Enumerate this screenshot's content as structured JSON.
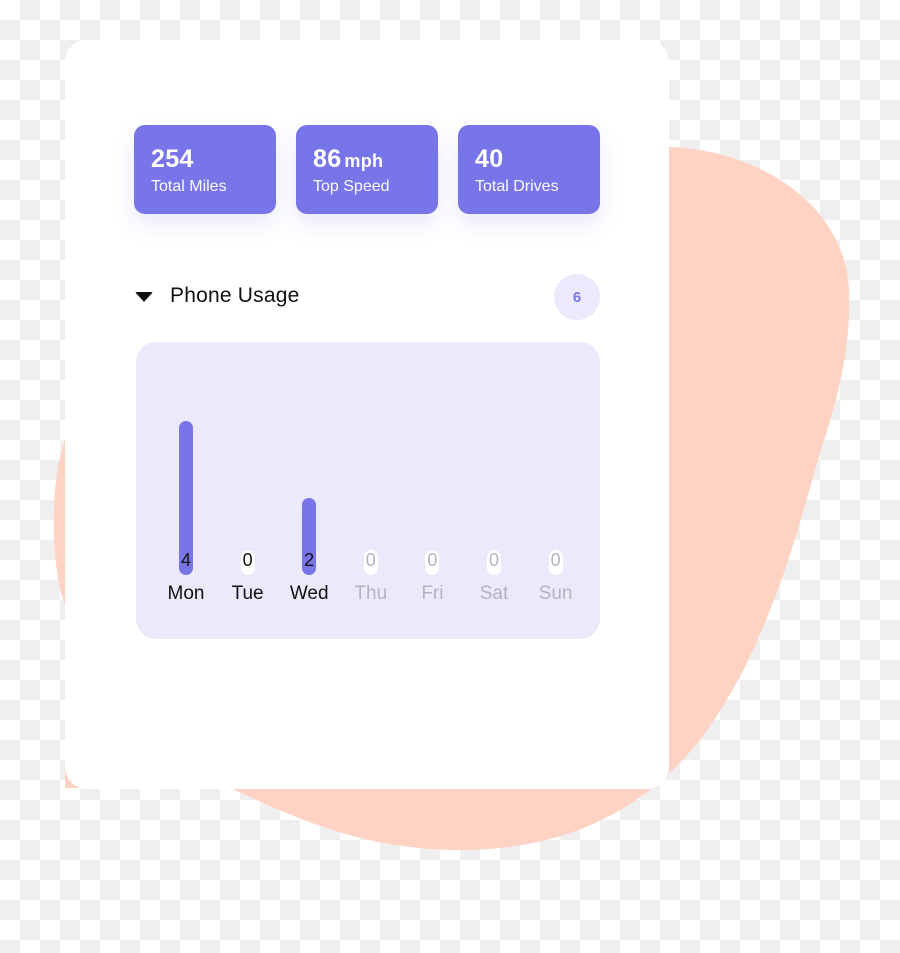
{
  "colors": {
    "accent": "#7775e8",
    "panel_bg": "#ebe9fa",
    "badge_bg": "#ebe9fb",
    "blob": "#fed3c3",
    "active_text": "#111111",
    "inactive_text": "#b4b3c2",
    "empty_bar": "#ffffff"
  },
  "stats": [
    {
      "value": "254",
      "unit": "",
      "label": "Total Miles"
    },
    {
      "value": "86",
      "unit": "mph",
      "label": "Top Speed"
    },
    {
      "value": "40",
      "unit": "",
      "label": "Total Drives"
    }
  ],
  "section": {
    "title": "Phone Usage",
    "count": "6",
    "icon": "caret-down-icon"
  },
  "chart_data": {
    "type": "bar",
    "title": "Phone Usage",
    "categories": [
      "Mon",
      "Tue",
      "Wed",
      "Thu",
      "Fri",
      "Sat",
      "Sun"
    ],
    "values": [
      4,
      0,
      2,
      0,
      0,
      0,
      0
    ],
    "active": [
      true,
      true,
      true,
      false,
      false,
      false,
      false
    ],
    "xlabel": "",
    "ylabel": "",
    "ylim": [
      0,
      4
    ],
    "grid": false,
    "legend": "none"
  }
}
